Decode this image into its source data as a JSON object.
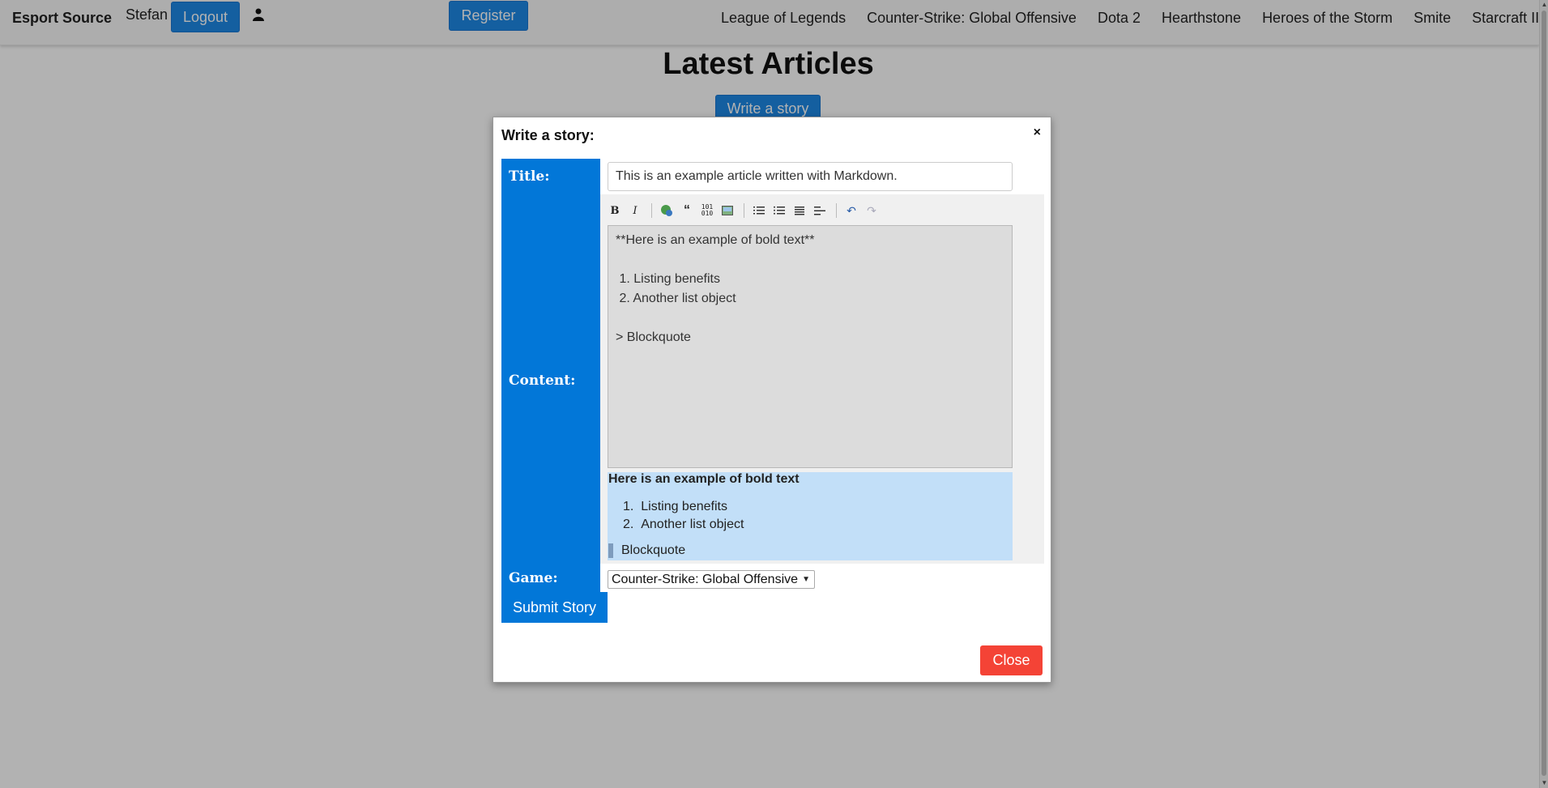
{
  "navbar": {
    "brand": "Esport Source",
    "username": "Stefan",
    "logout_label": "Logout",
    "register_label": "Register",
    "games": [
      "League of Legends",
      "Counter-Strike: Global Offensive",
      "Dota 2",
      "Hearthstone",
      "Heroes of the Storm",
      "Smite",
      "Starcraft II"
    ]
  },
  "main": {
    "title": "Latest Articles",
    "write_story_label": "Write a story"
  },
  "modal": {
    "title": "Write a story:",
    "close_x": "×",
    "labels": {
      "title": "Title:",
      "content": "Content:",
      "game": "Game:"
    },
    "title_value": "This is an example article written with Markdown.",
    "content_value": "**Here is an example of bold text**\n\n 1. Listing benefits\n 2. Another list object\n\n> Blockquote",
    "preview": {
      "bold": "Here is an example of bold text",
      "list": [
        "Listing benefits",
        "Another list object"
      ],
      "quote": "Blockquote"
    },
    "game_selected": "Counter-Strike: Global Offensive",
    "submit_label": "Submit Story",
    "close_label": "Close"
  },
  "toolbar": {
    "icons": [
      "bold-icon",
      "italic-icon",
      "link-icon",
      "quote-icon",
      "code-icon",
      "image-icon",
      "ordered-list-icon",
      "unordered-list-icon",
      "heading-icon",
      "horizontal-rule-icon",
      "undo-icon",
      "redo-icon"
    ]
  },
  "colors": {
    "accent": "#0277d8",
    "nav_button": "#1e88e5",
    "close_button": "#f44336",
    "preview_bg": "#c2dff8"
  }
}
